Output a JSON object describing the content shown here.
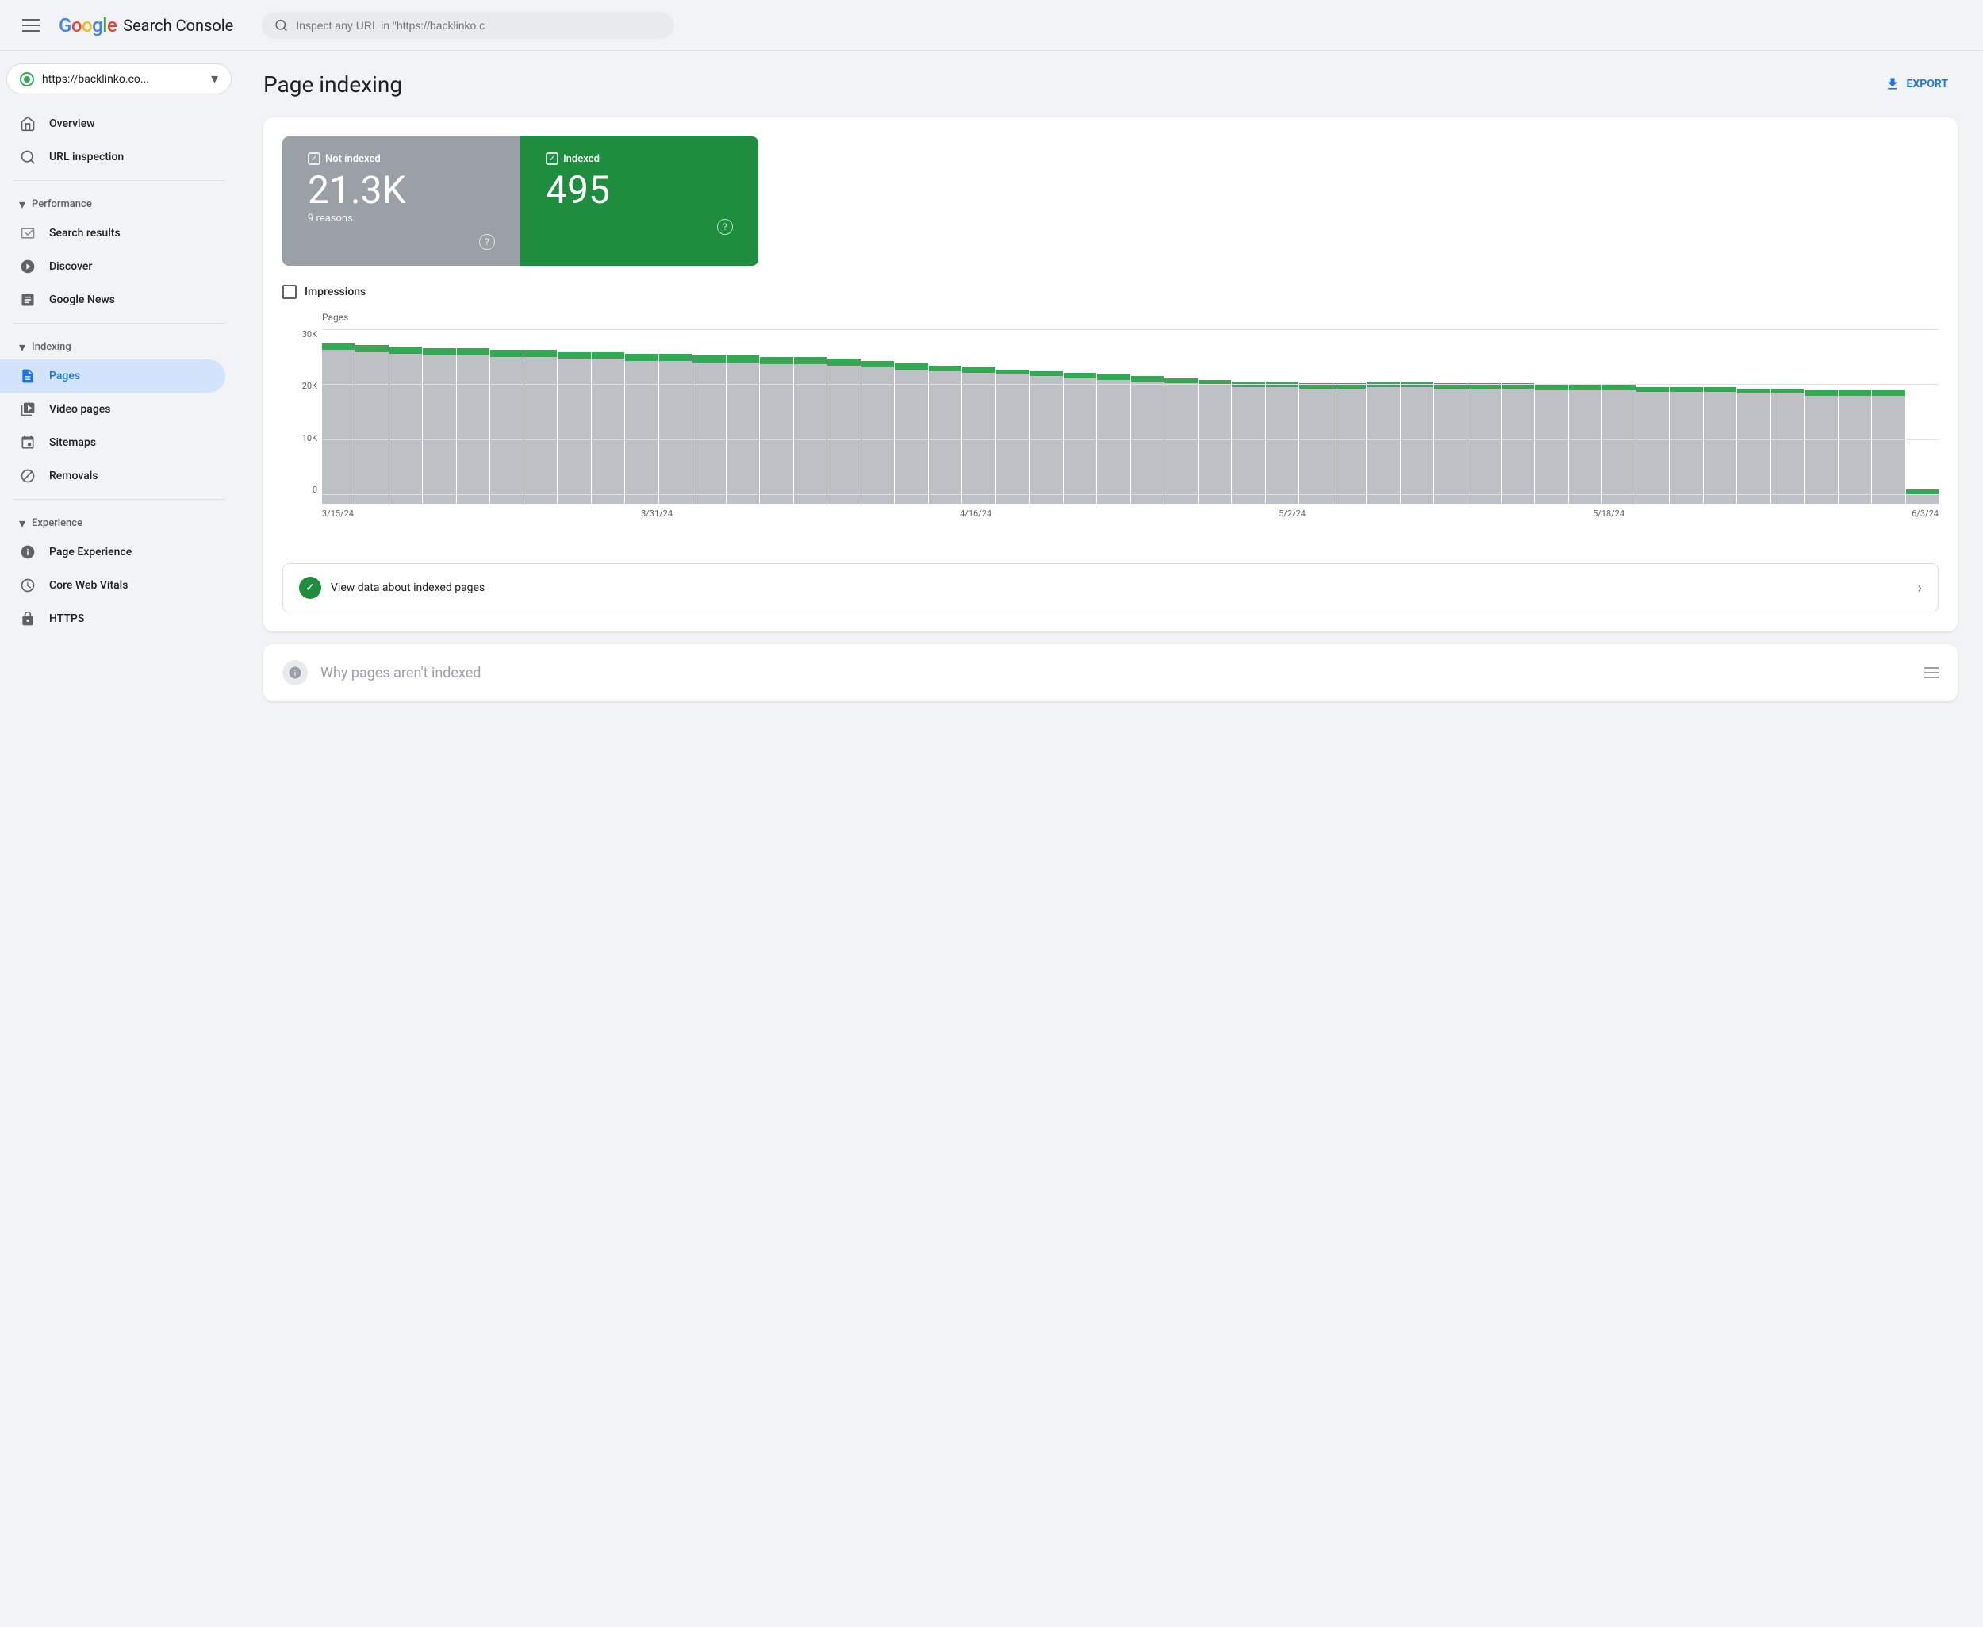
{
  "header": {
    "menu_icon": "hamburger",
    "google_logo": "Google",
    "app_name": "Search Console",
    "search_placeholder": "Inspect any URL in \"https://backlinko.c"
  },
  "site_selector": {
    "url": "https://backlinko.co...",
    "favicon_color": "#34a853"
  },
  "sidebar": {
    "overview_label": "Overview",
    "url_inspection_label": "URL inspection",
    "performance_section": "Performance",
    "search_results_label": "Search results",
    "discover_label": "Discover",
    "google_news_label": "Google News",
    "indexing_section": "Indexing",
    "pages_label": "Pages",
    "video_pages_label": "Video pages",
    "sitemaps_label": "Sitemaps",
    "removals_label": "Removals",
    "experience_section": "Experience",
    "page_experience_label": "Page Experience",
    "core_web_vitals_label": "Core Web Vitals",
    "https_label": "HTTPS"
  },
  "main": {
    "page_title": "Page indexing",
    "export_label": "EXPORT",
    "not_indexed": {
      "label": "Not indexed",
      "value": "21.3K",
      "sub": "9 reasons"
    },
    "indexed": {
      "label": "Indexed",
      "value": "495"
    },
    "impressions_label": "Impressions",
    "chart": {
      "y_label": "Pages",
      "y_axis": [
        "30K",
        "20K",
        "10K",
        "0"
      ],
      "x_axis": [
        "3/15/24",
        "3/31/24",
        "4/16/24",
        "5/2/24",
        "5/18/24",
        "6/3/24"
      ],
      "bars": [
        {
          "gray": 88,
          "green": 4
        },
        {
          "gray": 87,
          "green": 4
        },
        {
          "gray": 86,
          "green": 4
        },
        {
          "gray": 85,
          "green": 4
        },
        {
          "gray": 85,
          "green": 4
        },
        {
          "gray": 84,
          "green": 4
        },
        {
          "gray": 84,
          "green": 4
        },
        {
          "gray": 83,
          "green": 4
        },
        {
          "gray": 83,
          "green": 4
        },
        {
          "gray": 82,
          "green": 4
        },
        {
          "gray": 82,
          "green": 4
        },
        {
          "gray": 81,
          "green": 4
        },
        {
          "gray": 81,
          "green": 4
        },
        {
          "gray": 80,
          "green": 4
        },
        {
          "gray": 80,
          "green": 4
        },
        {
          "gray": 79,
          "green": 4
        },
        {
          "gray": 78,
          "green": 4
        },
        {
          "gray": 77,
          "green": 4
        },
        {
          "gray": 76,
          "green": 3
        },
        {
          "gray": 75,
          "green": 3
        },
        {
          "gray": 74,
          "green": 3
        },
        {
          "gray": 73,
          "green": 3
        },
        {
          "gray": 72,
          "green": 3
        },
        {
          "gray": 71,
          "green": 3
        },
        {
          "gray": 70,
          "green": 3
        },
        {
          "gray": 69,
          "green": 3
        },
        {
          "gray": 68,
          "green": 3
        },
        {
          "gray": 67,
          "green": 3
        },
        {
          "gray": 67,
          "green": 3
        },
        {
          "gray": 66,
          "green": 3
        },
        {
          "gray": 66,
          "green": 3
        },
        {
          "gray": 67,
          "green": 3
        },
        {
          "gray": 67,
          "green": 3
        },
        {
          "gray": 66,
          "green": 3
        },
        {
          "gray": 66,
          "green": 3
        },
        {
          "gray": 66,
          "green": 3
        },
        {
          "gray": 65,
          "green": 3
        },
        {
          "gray": 65,
          "green": 3
        },
        {
          "gray": 65,
          "green": 3
        },
        {
          "gray": 64,
          "green": 3
        },
        {
          "gray": 64,
          "green": 3
        },
        {
          "gray": 64,
          "green": 3
        },
        {
          "gray": 63,
          "green": 3
        },
        {
          "gray": 63,
          "green": 3
        },
        {
          "gray": 62,
          "green": 3
        },
        {
          "gray": 62,
          "green": 3
        },
        {
          "gray": 62,
          "green": 3
        },
        {
          "gray": 5,
          "green": 3
        }
      ]
    },
    "view_data_label": "View data about indexed pages",
    "why_pages_label": "Why pages aren't indexed"
  }
}
